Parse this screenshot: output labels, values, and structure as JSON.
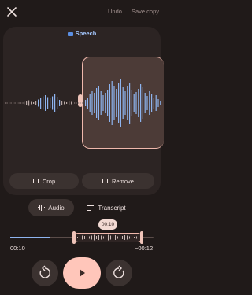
{
  "top_bar": {
    "close_icon": "close-icon",
    "undo_label": "Undo",
    "save_label": "Save copy"
  },
  "editor": {
    "speech_label": "Speech",
    "crop_label": "Crop",
    "remove_label": "Remove"
  },
  "tabs": {
    "audio_label": "Audio",
    "transcript_label": "Transcript",
    "selected": "Audio"
  },
  "timeline": {
    "bubble_time": "00:10",
    "start_time": "00:10",
    "end_time": "−00:12"
  },
  "controls": {
    "rewind_icon": "rewind-icon",
    "play_icon": "play-icon",
    "forward_icon": "forward-icon"
  },
  "colors": {
    "background": "#201a19",
    "panel": "#2c2423",
    "selection_fill": "#4c3b37",
    "accent": "#efb8ac",
    "wave_blue": "#8eb4ef",
    "play_button": "#ffc6ba"
  }
}
